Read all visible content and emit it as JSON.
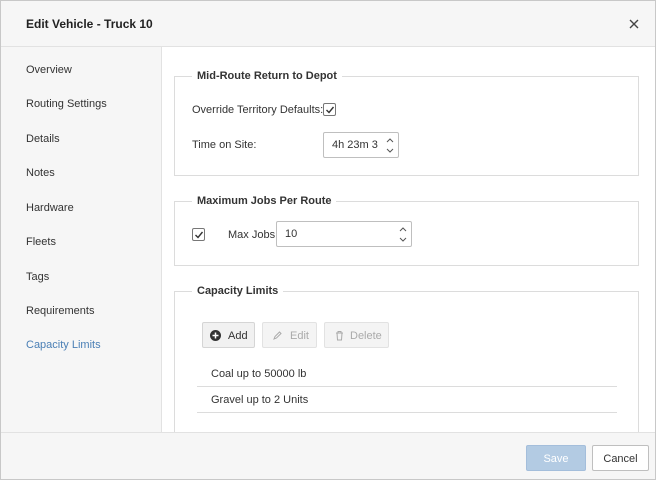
{
  "dialog": {
    "title": "Edit Vehicle - Truck 10"
  },
  "sidebar": {
    "items": [
      {
        "label": "Overview"
      },
      {
        "label": "Routing Settings"
      },
      {
        "label": "Details"
      },
      {
        "label": "Notes"
      },
      {
        "label": "Hardware"
      },
      {
        "label": "Fleets"
      },
      {
        "label": "Tags"
      },
      {
        "label": "Requirements"
      },
      {
        "label": "Capacity Limits",
        "active": true
      }
    ]
  },
  "mid_route": {
    "legend": "Mid-Route Return to Depot",
    "override_label": "Override Territory Defaults:",
    "override_checked": true,
    "time_label": "Time on Site:",
    "time_value": "4h 23m 3"
  },
  "max_jobs": {
    "legend": "Maximum Jobs Per Route",
    "enabled_checked": true,
    "label": "Max Jobs:",
    "value": "10"
  },
  "capacity": {
    "legend": "Capacity Limits",
    "add_label": "Add",
    "edit_label": "Edit",
    "delete_label": "Delete",
    "rows": [
      {
        "text": "Coal up to 50000 lb"
      },
      {
        "text": "Gravel up to 2 Units"
      }
    ]
  },
  "footer": {
    "save_label": "Save",
    "cancel_label": "Cancel"
  },
  "colors": {
    "active_nav": "#4a7fb5",
    "save_disabled": "#b3cbe3",
    "panel_bg": "#f6f6f6"
  },
  "icons": {
    "close": "close-icon",
    "add": "plus-circle-icon",
    "edit": "pencil-icon",
    "delete": "trash-icon",
    "check": "check-icon"
  }
}
